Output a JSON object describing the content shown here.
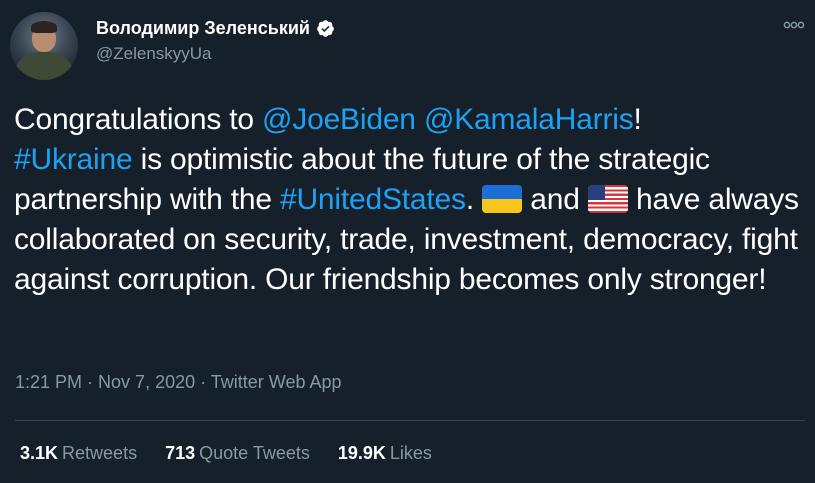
{
  "user": {
    "display_name": "Володимир Зеленський",
    "handle": "@ZelenskyyUa",
    "verified": true
  },
  "icons": {
    "verified": "verified-badge-icon",
    "more": "more-options-icon",
    "flag_ukraine": "flag-ukraine-icon",
    "flag_us": "flag-united-states-icon"
  },
  "tweet": {
    "line1_pre": "Congratulations to ",
    "mention_biden": "@JoeBiden",
    "space1": " ",
    "mention_harris": "@KamalaHarris",
    "line1_post": "!",
    "hashtag_ukraine": "#Ukraine",
    "text2": " is optimistic about the future of the strategic partnership with the ",
    "hashtag_us": "#UnitedStates",
    "text3": ". ",
    "text4": " and ",
    "text5": " have always collaborated on security, trade, investment, democracy, fight against corruption. Our friendship becomes only stronger!"
  },
  "meta": {
    "time": "1:21 PM",
    "sep1": " · ",
    "date": "Nov 7, 2020",
    "sep2": " · ",
    "source": "Twitter Web App"
  },
  "stats": {
    "retweets_count": "3.1K",
    "retweets_label": "Retweets",
    "quotes_count": "713",
    "quotes_label": "Quote Tweets",
    "likes_count": "19.9K",
    "likes_label": "Likes"
  },
  "colors": {
    "background": "#15202b",
    "link": "#1da1f2",
    "secondary_text": "#8899a6",
    "divider": "#38444d"
  }
}
